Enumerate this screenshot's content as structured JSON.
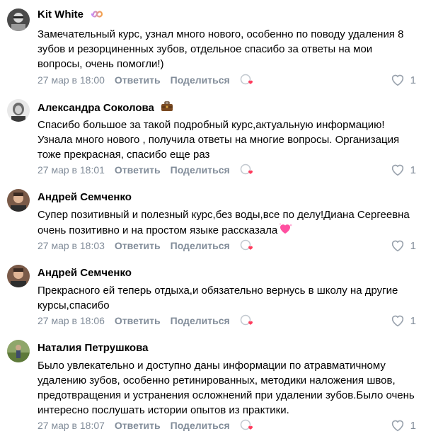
{
  "comments": [
    {
      "author": "Kit White",
      "badge_icon": "infinity-icon",
      "text": "Замечательный курс, узнал много нового, особенно по поводу удаления 8 зубов и резорциненных зубов, отдельное спасибо за ответы на мои вопросы, очень помогли!)",
      "time": "27 мар в 18:00",
      "reply_label": "Ответить",
      "share_label": "Поделиться",
      "likes": "1"
    },
    {
      "author": "Александра Соколова",
      "badge_icon": "briefcase-icon",
      "text": "Спасибо большое за такой подробный курс,актуальную информацию! Узнала много нового , получила ответы на многие вопросы. Организация тоже прекрасная, спасибо еще раз",
      "time": "27 мар в 18:01",
      "reply_label": "Ответить",
      "share_label": "Поделиться",
      "likes": "1"
    },
    {
      "author": "Андрей Семченко",
      "badge_icon": "",
      "text": "Супер позитивный и полезный курс,без воды,все по делу!Диана Сергеевна очень позитивно и на простом языке рассказала",
      "text_emoji": "sparkling-heart-icon",
      "time": "27 мар в 18:03",
      "reply_label": "Ответить",
      "share_label": "Поделиться",
      "likes": "1"
    },
    {
      "author": "Андрей Семченко",
      "badge_icon": "",
      "text": "Прекрасного ей теперь отдыха,и обязательно вернусь в школу на другие курсы,спасибо",
      "time": "27 мар в 18:06",
      "reply_label": "Ответить",
      "share_label": "Поделиться",
      "likes": "1"
    },
    {
      "author": "Наталия Петрушкова",
      "badge_icon": "",
      "text": "Было увлекательно и доступно даны информации по атравматичному удалению зубов, особенно ретинированных, методики наложения швов, предотвращения и устранения осложнений при удалении зубов.Было очень интересно послушать истории опытов из практики.",
      "time": "27 мар в 18:07",
      "reply_label": "Ответить",
      "share_label": "Поделиться",
      "likes": "1"
    }
  ],
  "colors": {
    "meta_gray": "#818c99",
    "infinity_gradient": [
      "#c58af9",
      "#f4a24b"
    ],
    "heart_pink": "#ff3b7f"
  }
}
